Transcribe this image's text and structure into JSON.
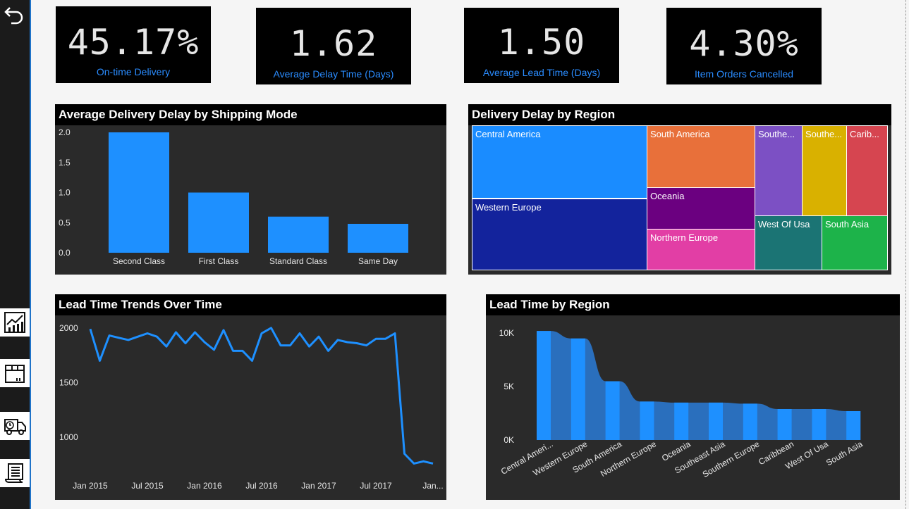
{
  "kpis": [
    {
      "value": "45.17%",
      "label": "On-time Delivery"
    },
    {
      "value": "1.62",
      "label": "Average Delay Time (Days)"
    },
    {
      "value": "1.50",
      "label": "Average Lead Time (Days)"
    },
    {
      "value": "4.30%",
      "label": "Item Orders Cancelled"
    }
  ],
  "nav": {
    "back_icon": "back-arrow-icon",
    "items": [
      {
        "icon": "performance-chart-icon"
      },
      {
        "icon": "package-icon"
      },
      {
        "icon": "delivery-truck-icon"
      },
      {
        "icon": "report-document-icon"
      }
    ]
  },
  "panels": {
    "delay_by_mode": {
      "title": "Average Delivery Delay by Shipping Mode"
    },
    "delay_by_region": {
      "title": "Delivery Delay by Region"
    },
    "lead_trend": {
      "title": "Lead Time Trends Over Time"
    },
    "lead_by_region": {
      "title": "Lead Time by Region"
    }
  },
  "colors": {
    "bar": "#1e90ff",
    "panel": "#2a2a2a",
    "title_bg": "#000000",
    "kpi_label": "#2a8cff"
  },
  "chart_data": [
    {
      "type": "bar",
      "title": "Average Delivery Delay by Shipping Mode",
      "categories": [
        "Second Class",
        "First Class",
        "Standard Class",
        "Same Day"
      ],
      "values": [
        2.0,
        1.0,
        0.6,
        0.48
      ],
      "yticks": [
        "0.0",
        "0.5",
        "1.0",
        "1.5",
        "2.0"
      ],
      "ylim": [
        0,
        2.0
      ]
    },
    {
      "type": "treemap",
      "title": "Delivery Delay by Region",
      "items": [
        {
          "label": "Central America",
          "color": "#1a8cff"
        },
        {
          "label": "Western Europe",
          "color": "#13239c"
        },
        {
          "label": "South America",
          "color": "#e8703a"
        },
        {
          "label": "Oceania",
          "color": "#6b0080"
        },
        {
          "label": "Northern Europe",
          "color": "#e23ea5"
        },
        {
          "label": "Southe...",
          "color": "#7c50c4"
        },
        {
          "label": "Southe...",
          "color": "#d9b100"
        },
        {
          "label": "Carib...",
          "color": "#d64550"
        },
        {
          "label": "West Of Usa",
          "color": "#1b7474"
        },
        {
          "label": "South Asia",
          "color": "#1db34a"
        }
      ]
    },
    {
      "type": "line",
      "title": "Lead Time Trends Over Time",
      "xticks": [
        "Jan 2015",
        "Jul 2015",
        "Jan 2016",
        "Jul 2016",
        "Jan 2017",
        "Jul 2017",
        "Jan..."
      ],
      "yticks": [
        "1000",
        "1500",
        "2000"
      ],
      "ylim": [
        750,
        2050
      ],
      "values": [
        1990,
        1700,
        1930,
        1910,
        1890,
        1920,
        1950,
        1920,
        1830,
        1960,
        1860,
        1960,
        1870,
        1800,
        1980,
        1790,
        1790,
        1700,
        1950,
        2000,
        1840,
        1840,
        1950,
        1830,
        1920,
        1790,
        1890,
        1870,
        1860,
        1840,
        1900,
        1900,
        1950,
        850,
        760,
        780,
        760
      ]
    },
    {
      "type": "bar",
      "title": "Lead Time by Region",
      "categories": [
        "Central Ameri...",
        "Western Europe",
        "South America",
        "Northern Europe",
        "Oceania",
        "Southeast Asia",
        "Southern Europe",
        "Caribbean",
        "West Of Usa",
        "South Asia"
      ],
      "values": [
        10200,
        9500,
        5500,
        3600,
        3500,
        3500,
        3400,
        2900,
        2900,
        2700
      ],
      "yticks": [
        "0K",
        "5K",
        "10K"
      ],
      "ylim": [
        0,
        11000
      ]
    }
  ]
}
